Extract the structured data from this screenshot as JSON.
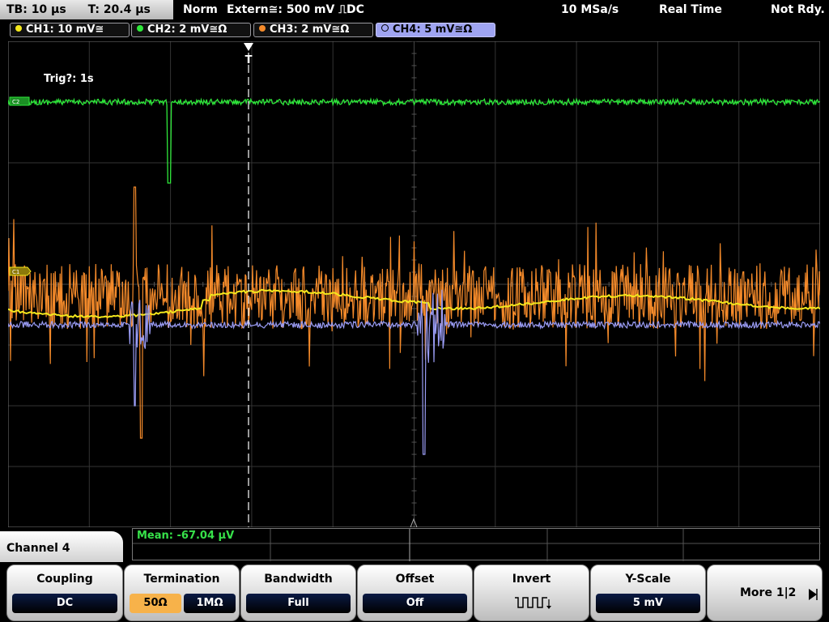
{
  "status": {
    "timebase": "TB: 10 µs",
    "trigger_time": "T: 20.4 µs",
    "mode": "Norm",
    "trigger_source": "Extern≅: 500 mV ⎍DC",
    "sample_rate": "10 MSa/s",
    "acq_mode": "Real Time",
    "state": "Not Rdy."
  },
  "channels": [
    {
      "label": "CH1: 10 mV≅",
      "color": "#f4e81c",
      "active": false
    },
    {
      "label": "CH2: 2 mV≅Ω",
      "color": "#2ee83a",
      "active": false
    },
    {
      "label": "CH3: 2 mV≅Ω",
      "color": "#f48a2a",
      "active": false
    },
    {
      "label": "CH4: 5 mV≅Ω",
      "color": "#9a9cf4",
      "active": true
    }
  ],
  "plot": {
    "trigger_info": "Trig?: 1s",
    "marker_labels": {
      "ch2": "C2",
      "ch1": "C1"
    }
  },
  "measurement": {
    "mean": "Mean: -67.04 µV"
  },
  "menu": {
    "title": "Channel 4",
    "coupling_label": "Coupling",
    "coupling_value": "DC",
    "termination_label": "Termination",
    "termination_opt1": "50Ω",
    "termination_opt2": "1MΩ",
    "bandwidth_label": "Bandwidth",
    "bandwidth_value": "Full",
    "offset_label": "Offset",
    "offset_value": "Off",
    "invert_label": "Invert",
    "yscale_label": "Y-Scale",
    "yscale_value": "5 mV",
    "more_label": "More 1|2"
  }
}
